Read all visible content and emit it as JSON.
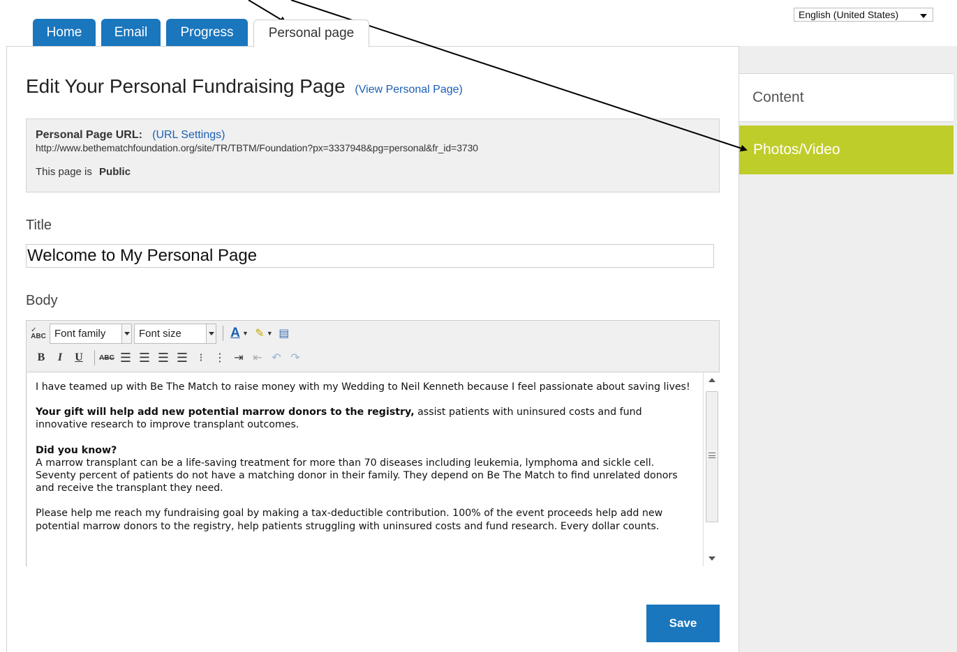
{
  "language_select": {
    "value": "English (United States)"
  },
  "tabs": [
    {
      "label": "Home"
    },
    {
      "label": "Email"
    },
    {
      "label": "Progress"
    },
    {
      "label": "Personal page"
    }
  ],
  "sidebar": {
    "items": [
      {
        "label": "Content"
      },
      {
        "label": "Photos/Video"
      }
    ],
    "active_color": "#bfcd2a"
  },
  "heading": {
    "title": "Edit Your Personal Fundraising Page",
    "view_link": "(View Personal Page)"
  },
  "url_box": {
    "label": "Personal Page URL:",
    "settings_link": "(URL Settings)",
    "url": "http://www.bethematchfoundation.org/site/TR/TBTM/Foundation?px=3337948&pg=personal&fr_id=3730",
    "status_prefix": "This page is",
    "status_value": "Public"
  },
  "title_field": {
    "label": "Title",
    "value": "Welcome to My Personal Page"
  },
  "body_field": {
    "label": "Body",
    "toolbar": {
      "font_family": "Font family",
      "font_size": "Font size"
    },
    "paragraphs": {
      "p1": "I have teamed up with Be The Match to raise money with my Wedding to Neil Kenneth because I feel passionate about saving lives!",
      "p2_bold": "Your gift will help add new potential marrow donors to the registry,",
      "p2_rest": " assist patients with uninsured costs and fund innovative research to improve transplant outcomes.",
      "p3_bold": "Did you know?",
      "p3_rest": "A marrow transplant can be a life-saving treatment for more than 70 diseases including leukemia, lymphoma and sickle cell. Seventy percent of patients do not have a matching donor in their family. They depend on Be The Match to find unrelated donors and receive the transplant they need.",
      "p4": "Please help me reach my fundraising goal by making a tax-deductible contribution. 100% of the event proceeds help add new potential marrow donors to the registry, help patients struggling with uninsured costs and fund research. Every dollar counts."
    }
  },
  "save_button": {
    "label": "Save"
  },
  "colors": {
    "tab_blue": "#1a76bd",
    "link_blue": "#1a5fb4",
    "sidebar_green": "#bfcd2a"
  }
}
